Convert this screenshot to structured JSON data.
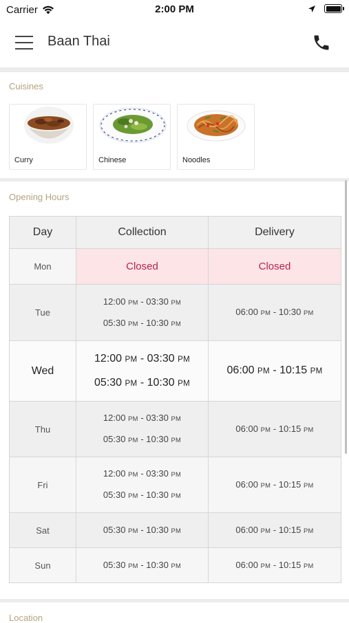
{
  "status_bar": {
    "carrier": "Carrier",
    "time": "2:00 PM"
  },
  "header": {
    "title": "Baan Thai"
  },
  "cuisines": {
    "title": "Cuisines",
    "items": [
      {
        "label": "Curry"
      },
      {
        "label": "Chinese"
      },
      {
        "label": "Noodles"
      }
    ]
  },
  "opening_hours": {
    "title": "Opening Hours",
    "columns": [
      "Day",
      "Collection",
      "Delivery"
    ],
    "rows": [
      {
        "day": "Mon",
        "collection": "Closed",
        "delivery": "Closed"
      },
      {
        "day": "Tue",
        "collection": [
          {
            "from": "12:00",
            "from_ampm": "PM",
            "to": "03:30",
            "to_ampm": "PM"
          },
          {
            "from": "05:30",
            "from_ampm": "PM",
            "to": "10:30",
            "to_ampm": "PM"
          }
        ],
        "delivery": [
          {
            "from": "06:00",
            "from_ampm": "PM",
            "to": "10:30",
            "to_ampm": "PM"
          }
        ]
      },
      {
        "day": "Wed",
        "collection": [
          {
            "from": "12:00",
            "from_ampm": "PM",
            "to": "03:30",
            "to_ampm": "PM"
          },
          {
            "from": "05:30",
            "from_ampm": "PM",
            "to": "10:30",
            "to_ampm": "PM"
          }
        ],
        "delivery": [
          {
            "from": "06:00",
            "from_ampm": "PM",
            "to": "10:15",
            "to_ampm": "PM"
          }
        ]
      },
      {
        "day": "Thu",
        "collection": [
          {
            "from": "12:00",
            "from_ampm": "PM",
            "to": "03:30",
            "to_ampm": "PM"
          },
          {
            "from": "05:30",
            "from_ampm": "PM",
            "to": "10:30",
            "to_ampm": "PM"
          }
        ],
        "delivery": [
          {
            "from": "06:00",
            "from_ampm": "PM",
            "to": "10:15",
            "to_ampm": "PM"
          }
        ]
      },
      {
        "day": "Fri",
        "collection": [
          {
            "from": "12:00",
            "from_ampm": "PM",
            "to": "03:30",
            "to_ampm": "PM"
          },
          {
            "from": "05:30",
            "from_ampm": "PM",
            "to": "10:30",
            "to_ampm": "PM"
          }
        ],
        "delivery": [
          {
            "from": "06:00",
            "from_ampm": "PM",
            "to": "10:15",
            "to_ampm": "PM"
          }
        ]
      },
      {
        "day": "Sat",
        "collection": [
          {
            "from": "05:30",
            "from_ampm": "PM",
            "to": "10:30",
            "to_ampm": "PM"
          }
        ],
        "delivery": [
          {
            "from": "06:00",
            "from_ampm": "PM",
            "to": "10:15",
            "to_ampm": "PM"
          }
        ]
      },
      {
        "day": "Sun",
        "collection": [
          {
            "from": "05:30",
            "from_ampm": "PM",
            "to": "10:30",
            "to_ampm": "PM"
          }
        ],
        "delivery": [
          {
            "from": "06:00",
            "from_ampm": "PM",
            "to": "10:15",
            "to_ampm": "PM"
          }
        ]
      }
    ]
  },
  "location": {
    "title": "Location"
  },
  "colors": {
    "section_title": "#b3a37f",
    "closed_text": "#b8234a",
    "closed_bg": "#fce4e7"
  },
  "icons": [
    "wifi-icon",
    "location-arrow-icon",
    "battery-icon",
    "hamburger-menu-icon",
    "phone-icon"
  ]
}
